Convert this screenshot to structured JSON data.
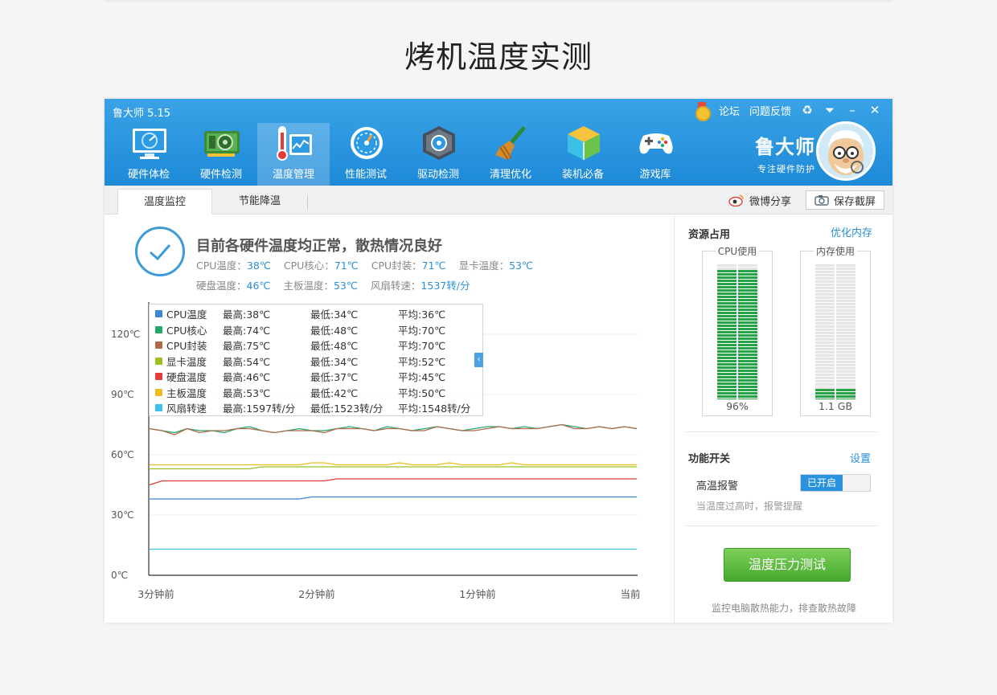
{
  "page": {
    "title": "烤机温度实测"
  },
  "app": {
    "name": "鲁大师 5.15",
    "top_links": [
      "论坛",
      "问题反馈"
    ],
    "nav": [
      {
        "label": "硬件体检",
        "icon": "monitor-icon"
      },
      {
        "label": "硬件检测",
        "icon": "graphics-card-icon"
      },
      {
        "label": "温度管理",
        "icon": "thermometer-icon"
      },
      {
        "label": "性能测试",
        "icon": "speedometer-icon"
      },
      {
        "label": "驱动检测",
        "icon": "gear-cube-icon"
      },
      {
        "label": "清理优化",
        "icon": "broom-icon"
      },
      {
        "label": "装机必备",
        "icon": "box-icon"
      },
      {
        "label": "游戏库",
        "icon": "gamepad-icon"
      }
    ],
    "active_nav": 2,
    "brand_name": "鲁大师",
    "brand_slogan": "专注硬件防护"
  },
  "tabs": {
    "monitor": "温度监控",
    "cooling": "节能降温",
    "share": "微博分享",
    "screenshot": "保存截屏"
  },
  "status": {
    "headline": "目前各硬件温度均正常，散热情况良好",
    "items": [
      {
        "label": "CPU温度：",
        "value": "38℃"
      },
      {
        "label": "CPU核心：",
        "value": "71℃"
      },
      {
        "label": "CPU封装：",
        "value": "71℃"
      },
      {
        "label": "显卡温度：",
        "value": "53℃"
      },
      {
        "label": "硬盘温度：",
        "value": "46℃"
      },
      {
        "label": "主板温度：",
        "value": "53℃"
      },
      {
        "label": "风扇转速：",
        "value": "1537转/分"
      }
    ]
  },
  "legend": [
    {
      "name": "CPU温度",
      "max": "最高:38℃",
      "min": "最低:34℃",
      "avg": "平均:36℃",
      "color": "#3a87d6"
    },
    {
      "name": "CPU核心",
      "max": "最高:74℃",
      "min": "最低:48℃",
      "avg": "平均:70℃",
      "color": "#22a96b"
    },
    {
      "name": "CPU封装",
      "max": "最高:75℃",
      "min": "最低:48℃",
      "avg": "平均:70℃",
      "color": "#b0694a"
    },
    {
      "name": "显卡温度",
      "max": "最高:54℃",
      "min": "最低:34℃",
      "avg": "平均:52℃",
      "color": "#9dc120"
    },
    {
      "name": "硬盘温度",
      "max": "最高:46℃",
      "min": "最低:37℃",
      "avg": "平均:45℃",
      "color": "#e23c3c"
    },
    {
      "name": "主板温度",
      "max": "最高:53℃",
      "min": "最低:42℃",
      "avg": "平均:50℃",
      "color": "#f0bd20"
    },
    {
      "name": "风扇转速",
      "max": "最高:1597转/分",
      "min": "最低:1523转/分",
      "avg": "平均:1548转/分",
      "color": "#3fc0ea"
    }
  ],
  "chart_data": {
    "type": "line",
    "y_ticks": [
      "120℃",
      "90℃",
      "60℃",
      "30℃",
      "0℃"
    ],
    "x_ticks": [
      "3分钟前",
      "2分钟前",
      "1分钟前",
      "当前"
    ],
    "ylim": [
      0,
      120
    ],
    "series": [
      {
        "name": "CPU核心",
        "color": "#22a96b",
        "values": [
          73,
          72,
          71,
          73,
          72,
          72,
          71,
          73,
          74,
          72,
          71,
          72,
          73,
          72,
          72,
          73,
          74,
          73,
          72,
          74,
          73,
          72,
          73,
          74,
          73,
          72,
          73,
          74,
          74,
          73,
          74,
          73,
          74,
          75,
          74,
          73,
          74,
          73,
          74,
          73
        ]
      },
      {
        "name": "CPU封装",
        "color": "#b0694a",
        "values": [
          73,
          72,
          70,
          73,
          71,
          72,
          72,
          73,
          73,
          72,
          71,
          72,
          72,
          72,
          71,
          73,
          73,
          73,
          72,
          73,
          73,
          72,
          72,
          74,
          73,
          72,
          72,
          73,
          74,
          73,
          73,
          73,
          74,
          75,
          73,
          73,
          74,
          73,
          74,
          73
        ]
      },
      {
        "name": "显卡温度",
        "color": "#9dc120",
        "values": [
          53,
          53,
          53,
          53,
          53,
          53,
          53,
          53,
          53,
          54,
          54,
          54,
          54,
          54,
          54,
          54,
          54,
          54,
          54,
          54,
          54,
          54,
          54,
          54,
          54,
          54,
          54,
          54,
          54,
          54,
          54,
          54,
          54,
          54,
          54,
          54,
          54,
          54,
          54,
          54
        ]
      },
      {
        "name": "主板温度",
        "color": "#f0bd20",
        "values": [
          55,
          55,
          55,
          55,
          55,
          55,
          55,
          55,
          55,
          55,
          55,
          55,
          55,
          56,
          56,
          55,
          55,
          55,
          55,
          55,
          56,
          55,
          55,
          55,
          56,
          55,
          55,
          55,
          55,
          56,
          55,
          55,
          55,
          55,
          55,
          55,
          55,
          55,
          55,
          55
        ]
      },
      {
        "name": "硬盘温度",
        "color": "#e23c3c",
        "values": [
          45,
          47,
          47,
          47,
          47,
          47,
          47,
          47,
          47,
          47,
          47,
          47,
          47,
          47,
          47,
          48,
          48,
          48,
          48,
          48,
          48,
          48,
          48,
          48,
          48,
          48,
          48,
          48,
          48,
          48,
          48,
          48,
          48,
          48,
          48,
          48,
          48,
          48,
          48,
          48
        ]
      },
      {
        "name": "CPU温度",
        "color": "#3a87d6",
        "values": [
          38,
          38,
          38,
          38,
          38,
          38,
          38,
          38,
          38,
          38,
          38,
          38,
          38,
          39,
          39,
          39,
          39,
          39,
          39,
          39,
          39,
          39,
          39,
          39,
          39,
          39,
          39,
          39,
          39,
          39,
          39,
          39,
          39,
          39,
          39,
          39,
          39,
          39,
          39,
          39
        ]
      },
      {
        "name": "风扇转速",
        "color": "#3fc0ea",
        "values": [
          13,
          13,
          13,
          13,
          13,
          13,
          13,
          13,
          13,
          13,
          13,
          13,
          13,
          13,
          13,
          13,
          13,
          13,
          13,
          13,
          13,
          13,
          13,
          13,
          13,
          13,
          13,
          13,
          13,
          13,
          13,
          13,
          13,
          13,
          13,
          13,
          13,
          13,
          13,
          13
        ]
      }
    ]
  },
  "side": {
    "resources_title": "资源占用",
    "optimize_link": "优化内存",
    "cpu_meter": {
      "title": "CPU使用",
      "value": "96%",
      "fraction": 0.96
    },
    "mem_meter": {
      "title": "内存使用",
      "value": "1.1 GB",
      "fraction": 0.08
    },
    "switch_title": "功能开关",
    "settings_link": "设置",
    "alarm_label": "高温报警",
    "alarm_state": "已开启",
    "alarm_note": "当温度过高时，报警提醒",
    "stress_button": "温度压力测试",
    "footer": "监控电脑散热能力，排查散热故障"
  }
}
